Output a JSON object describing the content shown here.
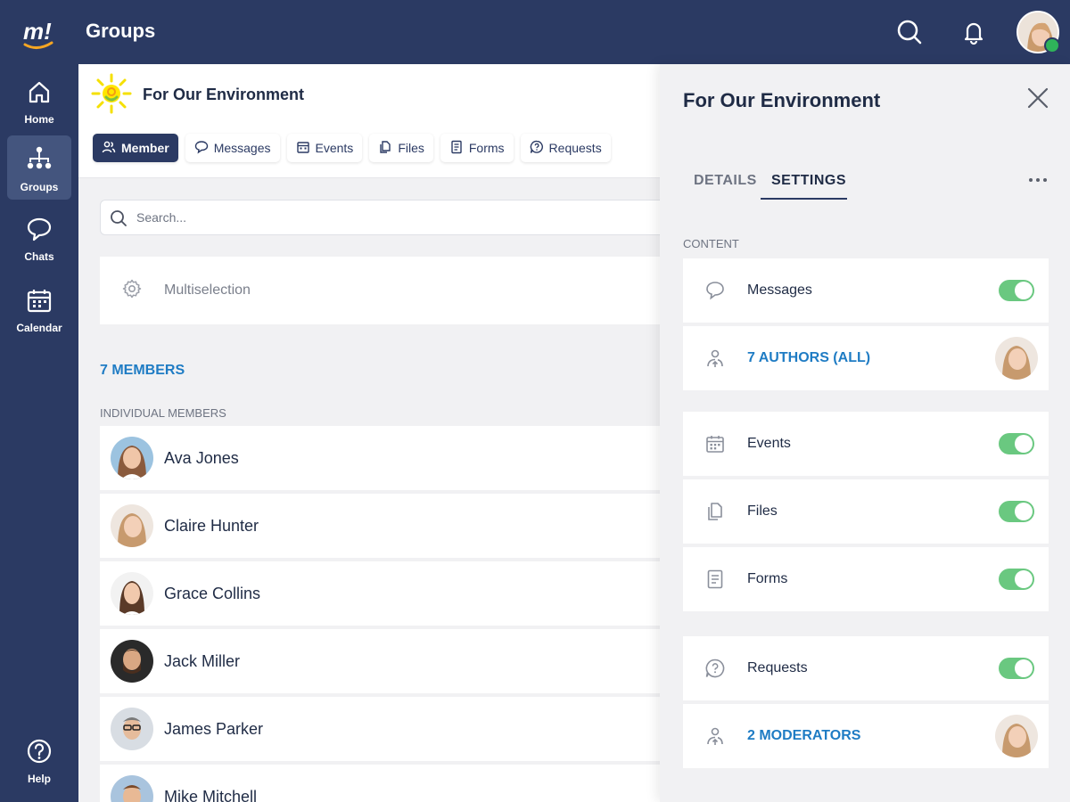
{
  "app": {
    "title": "Groups",
    "logo": "m!"
  },
  "sidebar": {
    "items": [
      {
        "label": "Home",
        "icon": "home-icon"
      },
      {
        "label": "Groups",
        "icon": "groups-icon",
        "active": true
      },
      {
        "label": "Chats",
        "icon": "chat-icon"
      },
      {
        "label": "Calendar",
        "icon": "calendar-icon"
      }
    ],
    "help": {
      "label": "Help",
      "icon": "help-icon"
    }
  },
  "group": {
    "name": "For Our Environment",
    "tabs": [
      {
        "label": "Member",
        "icon": "members-icon",
        "active": true
      },
      {
        "label": "Messages",
        "icon": "message-icon"
      },
      {
        "label": "Events",
        "icon": "calendar-icon"
      },
      {
        "label": "Files",
        "icon": "files-icon"
      },
      {
        "label": "Forms",
        "icon": "forms-icon"
      },
      {
        "label": "Requests",
        "icon": "requests-icon"
      }
    ]
  },
  "search": {
    "placeholder": "Search..."
  },
  "multiselection": {
    "label": "Multiselection"
  },
  "members": {
    "count_label": "7 MEMBERS",
    "section_label": "INDIVIDUAL MEMBERS",
    "list": [
      {
        "name": "Ava Jones"
      },
      {
        "name": "Claire Hunter"
      },
      {
        "name": "Grace Collins"
      },
      {
        "name": "Jack Miller"
      },
      {
        "name": "James Parker"
      },
      {
        "name": "Mike Mitchell"
      }
    ]
  },
  "panel": {
    "title": "For Our Environment",
    "tabs": [
      {
        "label": "DETAILS",
        "active": false
      },
      {
        "label": "SETTINGS",
        "active": true
      }
    ],
    "content_label": "CONTENT",
    "settings": [
      {
        "label": "Messages",
        "icon": "message-icon",
        "enabled": true
      },
      {
        "label": "7 AUTHORS (ALL)",
        "icon": "person-upload-icon",
        "link": true
      },
      {
        "label": "Events",
        "icon": "calendar-icon",
        "enabled": true
      },
      {
        "label": "Files",
        "icon": "files-icon",
        "enabled": true
      },
      {
        "label": "Forms",
        "icon": "forms-icon",
        "enabled": true
      },
      {
        "label": "Requests",
        "icon": "requests-icon",
        "enabled": true
      },
      {
        "label": "2 MODERATORS",
        "icon": "person-upload-icon",
        "link": true
      }
    ]
  },
  "colors": {
    "navy": "#2b3a63",
    "accent_blue": "#1f7cc4",
    "toggle_on": "#6ac880",
    "online": "#2fb35a"
  }
}
